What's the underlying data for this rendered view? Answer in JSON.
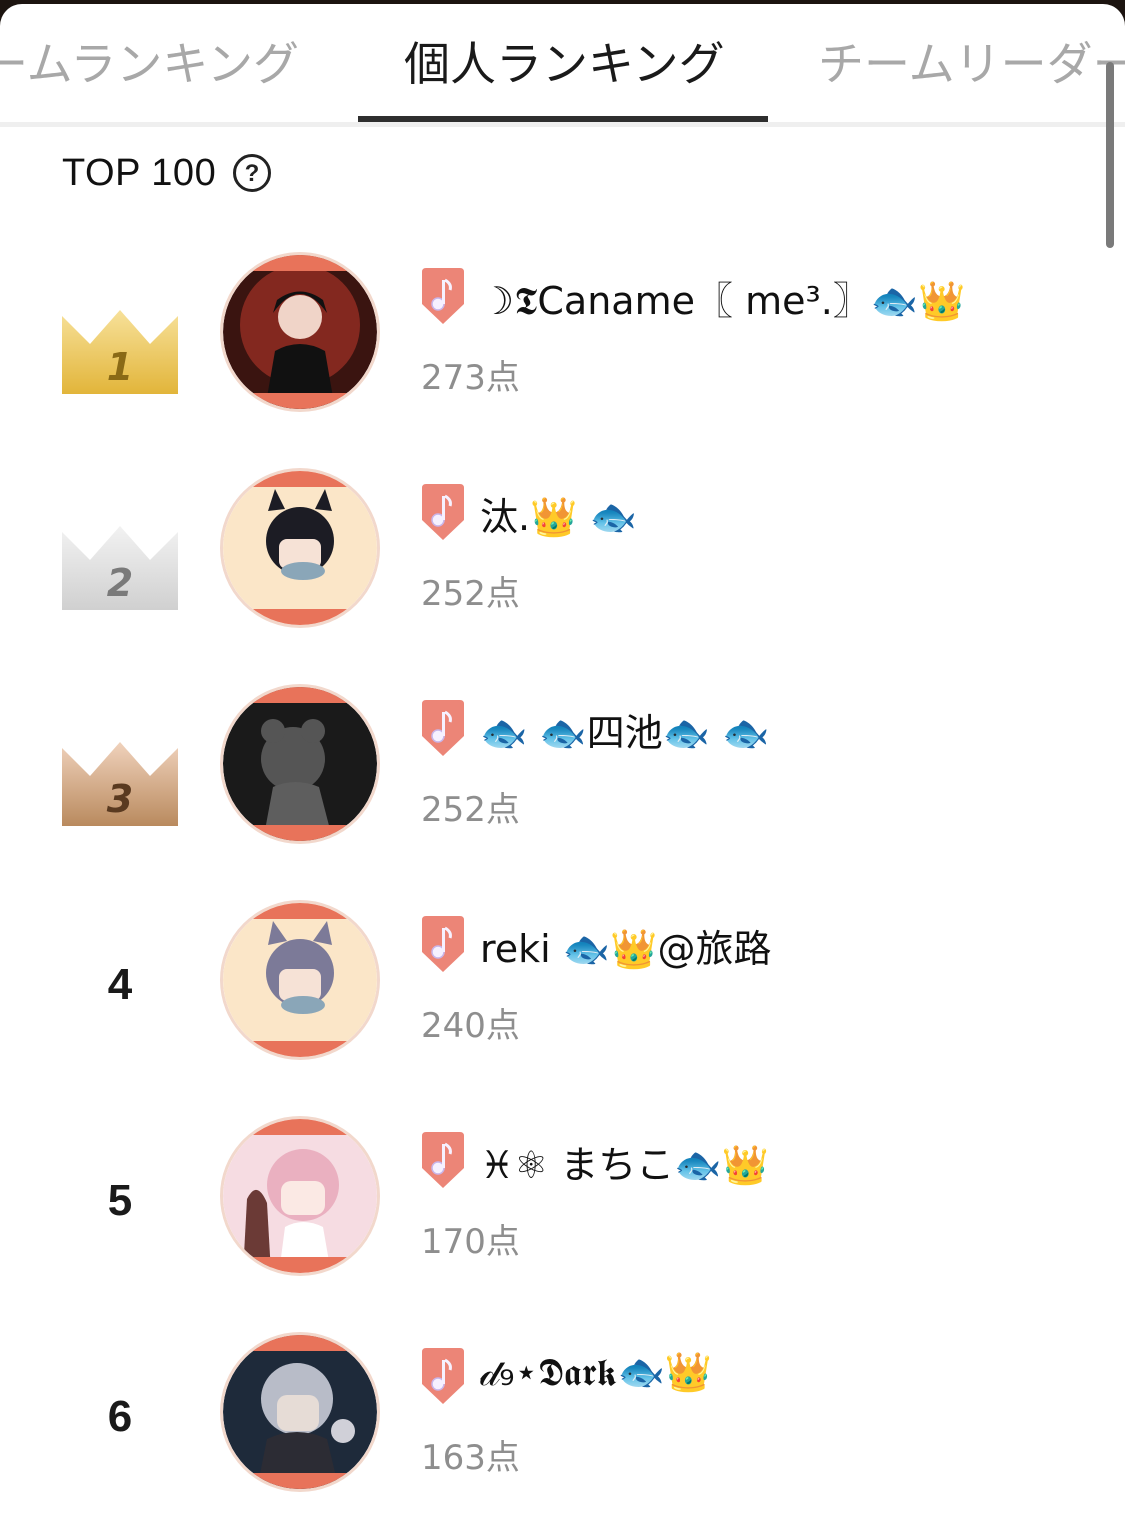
{
  "tabs": [
    {
      "label": "ームランキング",
      "active": false
    },
    {
      "label": "個人ランキング",
      "active": true
    },
    {
      "label": "チームリーダー",
      "active": false
    }
  ],
  "header": {
    "title": "TOP 100",
    "help_icon": "question-circle-icon"
  },
  "colors": {
    "gold": "#e9c24a",
    "silver": "#d8d8d8",
    "bronze": "#b98a5e",
    "badge": "#ec8577",
    "avatar_accent": "#e8735a"
  },
  "ranking": [
    {
      "rank": "1",
      "rank_style": "gold-crown",
      "name": "☽𝕿Caname〖 me³.〗🐟👑",
      "score": "273点"
    },
    {
      "rank": "2",
      "rank_style": "silver-crown",
      "name": "汰.👑 🐟",
      "score": "252点"
    },
    {
      "rank": "3",
      "rank_style": "bronze-crown",
      "name": "🐟 🐟四池🐟 🐟",
      "score": "252点"
    },
    {
      "rank": "4",
      "rank_style": "number",
      "name": "reki 🐟👑@旅路",
      "score": "240点"
    },
    {
      "rank": "5",
      "rank_style": "number",
      "name": "♓⚛ まちこ🐟👑",
      "score": "170点"
    },
    {
      "rank": "6",
      "rank_style": "number",
      "name": "𝒹₉⋆𝕯𝖆𝖗𝖐🐟👑",
      "score": "163点"
    }
  ]
}
